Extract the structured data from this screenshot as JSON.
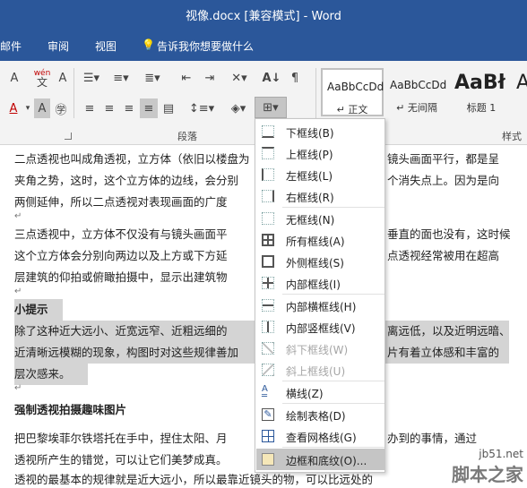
{
  "window": {
    "title": "视像.docx [兼容模式]  -  Word"
  },
  "menu": {
    "items": [
      "邮件",
      "审阅",
      "视图"
    ],
    "tell_me": "告诉我你想要做什么"
  },
  "ribbon": {
    "paragraph_group_label": "段落",
    "styles_group_label": "样式",
    "styles": [
      {
        "sample": "AaBbCcDd",
        "name": "↵ 正文"
      },
      {
        "sample": "AaBbCcDd",
        "name": "↵ 无间隔"
      },
      {
        "sample": "AaBł",
        "name": "标题 1"
      },
      {
        "sample": "A",
        "name": ""
      }
    ],
    "phonetic_label": "wén",
    "phonetic_char": "文"
  },
  "border_menu": {
    "items": [
      {
        "label": "下框线(B)",
        "icon": "border-bottom-icon",
        "disabled": false
      },
      {
        "label": "上框线(P)",
        "icon": "border-top-icon",
        "disabled": false
      },
      {
        "label": "左框线(L)",
        "icon": "border-left-icon",
        "disabled": false
      },
      {
        "label": "右框线(R)",
        "icon": "border-right-icon",
        "disabled": false
      },
      {
        "label": "无框线(N)",
        "icon": "border-none-icon",
        "disabled": false
      },
      {
        "label": "所有框线(A)",
        "icon": "border-all-icon",
        "disabled": false
      },
      {
        "label": "外侧框线(S)",
        "icon": "border-outside-icon",
        "disabled": false
      },
      {
        "label": "内部框线(I)",
        "icon": "border-inside-icon",
        "disabled": false
      },
      {
        "label": "内部横框线(H)",
        "icon": "border-inside-horizontal-icon",
        "disabled": false
      },
      {
        "label": "内部竖框线(V)",
        "icon": "border-inside-vertical-icon",
        "disabled": false
      },
      {
        "label": "斜下框线(W)",
        "icon": "diagonal-down-icon",
        "disabled": true
      },
      {
        "label": "斜上框线(U)",
        "icon": "diagonal-up-icon",
        "disabled": true
      },
      {
        "label": "横线(Z)",
        "icon": "horizontal-line-icon",
        "disabled": false
      },
      {
        "label": "绘制表格(D)",
        "icon": "draw-table-icon",
        "disabled": false
      },
      {
        "label": "查看网格线(G)",
        "icon": "view-gridlines-icon",
        "disabled": false
      },
      {
        "label": "边框和底纹(O)...",
        "icon": "borders-shading-icon",
        "disabled": false
      }
    ]
  },
  "document": {
    "lines": [
      "二点透视也叫成角透视，立方体（依旧以楼盘为",
      "夹角之势，这时，这个立方体的边线，会分别",
      "两侧延伸，所以二点透视对表现画面的广度",
      "三点透视中，立方体不仅没有与镜头画面平",
      "这个立方体会分别向两边以及上方或下方延",
      "层建筑的仰拍或俯瞰拍摄中，显示出建筑物",
      "小提示",
      "除了这种近大远小、近宽远窄、近粗远细的",
      "近清晰远模糊的现象，构图时对这些规律善加",
      "层次感来。",
      "强制透视拍摄趣味图片",
      "把巴黎埃菲尔铁塔托在手中，捏住太阳、月",
      "透视所产生的错觉，可以让它们美梦成真。",
      "透视的最基本的规律就是近大远小，所以最靠近镜头的物，可以比远处的"
    ],
    "right_fragments": [
      "镜头画面平行，都是呈",
      "个消失点上。因为是向",
      "垂直的面也没有，这时候",
      "点透视经常被用在超高",
      "离远低，以及近明远暗、",
      "片有着立体感和丰富的",
      "办到的事情，通过",
      "可以比远处的"
    ]
  },
  "watermark": {
    "site": "jb51.net",
    "name": "脚本之家"
  }
}
